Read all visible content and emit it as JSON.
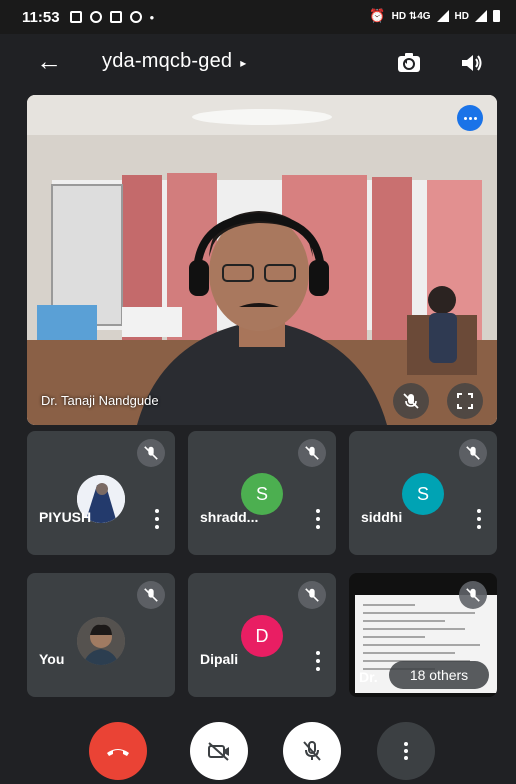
{
  "status_bar": {
    "time": "11:53",
    "network": "HD ⇅4G",
    "network2": "HD"
  },
  "header": {
    "meeting_code": "yda-mqcb-ged",
    "caret": "▸"
  },
  "main": {
    "presenter_name": "Dr. Tanaji Nandgude"
  },
  "participants": [
    {
      "name": "PIYUSH",
      "type": "photo"
    },
    {
      "name": "shradd...",
      "type": "letter",
      "initial": "S",
      "color": "#4caf50"
    },
    {
      "name": "siddhi",
      "type": "letter",
      "initial": "S",
      "color": "#00a3b4"
    },
    {
      "name": "You",
      "type": "photo"
    },
    {
      "name": "Dipali",
      "type": "letter",
      "initial": "D",
      "color": "#e91e63"
    }
  ],
  "others": {
    "label": "18 others",
    "name_prefix": "Dr."
  },
  "controls": {
    "end_call_color": "#ea4335"
  }
}
